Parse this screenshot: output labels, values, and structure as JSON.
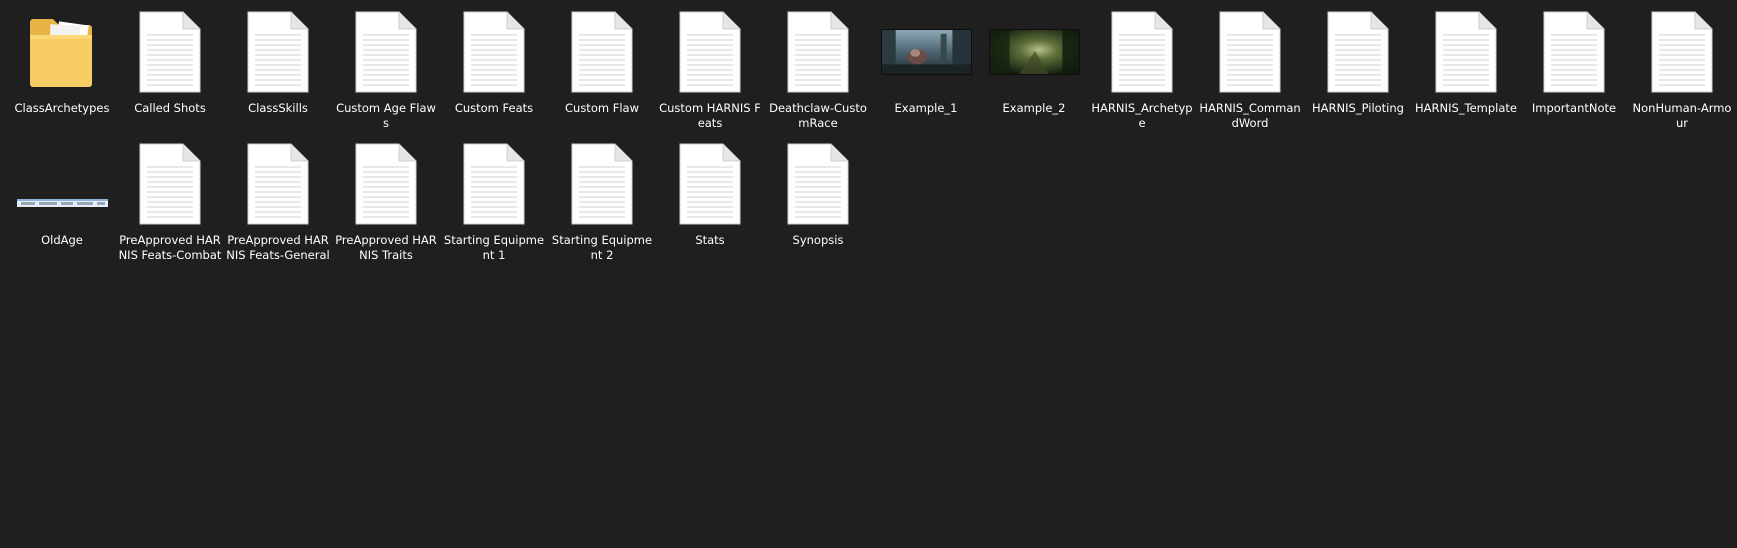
{
  "desktop": {
    "row1": [
      {
        "label": "ClassArchetypes",
        "type": "folder-icon"
      },
      {
        "label": "Called Shots",
        "type": "document-icon"
      },
      {
        "label": "ClassSkills",
        "type": "document-icon"
      },
      {
        "label": "Custom Age Flaws",
        "type": "document-icon"
      },
      {
        "label": "Custom Feats",
        "type": "document-icon"
      },
      {
        "label": "Custom Flaw",
        "type": "document-icon"
      },
      {
        "label": "Custom HARNIS Feats",
        "type": "document-icon"
      },
      {
        "label": "Deathclaw-CustomRace",
        "type": "document-icon"
      },
      {
        "label": "Example_1",
        "type": "image-thumbnail-icon"
      },
      {
        "label": "Example_2",
        "type": "image-thumbnail-icon"
      },
      {
        "label": "HARNIS_Archetype",
        "type": "document-icon"
      },
      {
        "label": "HARNIS_CommandWord",
        "type": "document-icon"
      },
      {
        "label": "HARNIS_Piloting",
        "type": "document-icon"
      },
      {
        "label": "HARNIS_Template",
        "type": "document-icon"
      },
      {
        "label": "ImportantNote",
        "type": "document-icon"
      },
      {
        "label": "NonHuman-Armour",
        "type": "document-icon"
      }
    ],
    "row2": [
      {
        "label": "OldAge",
        "type": "image-thumbnail-icon"
      },
      {
        "label": "PreApproved HARNIS Feats-Combat",
        "type": "document-icon"
      },
      {
        "label": "PreApproved HARNIS Feats-General",
        "type": "document-icon"
      },
      {
        "label": "PreApproved HARNIS Traits",
        "type": "document-icon"
      },
      {
        "label": "Starting Equipment 1",
        "type": "document-icon"
      },
      {
        "label": "Starting Equipment 2",
        "type": "document-icon"
      },
      {
        "label": "Stats",
        "type": "document-icon"
      },
      {
        "label": "Synopsis",
        "type": "document-icon"
      }
    ],
    "colors": {
      "background": "#1f1f1f",
      "label_text": "#ffffff",
      "folder": "#f5c65a",
      "document_page": "#ffffff"
    }
  }
}
